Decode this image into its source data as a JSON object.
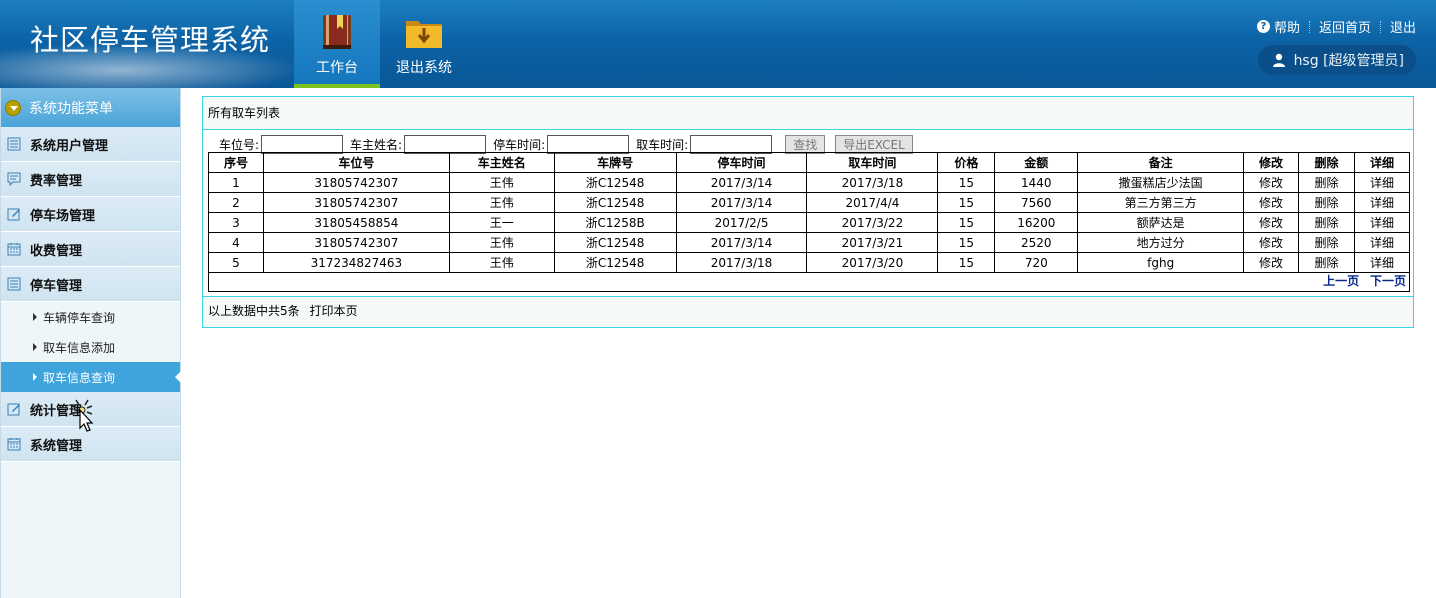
{
  "header": {
    "app_title": "社区停车管理系统",
    "nav": [
      {
        "label": "工作台",
        "icon": "book-icon",
        "active": true
      },
      {
        "label": "退出系统",
        "icon": "download-folder-icon",
        "active": false
      }
    ],
    "links": {
      "help": "帮助",
      "home": "返回首页",
      "logout": "退出"
    },
    "user": "hsg [超级管理员]"
  },
  "sidebar": {
    "header": "系统功能菜单",
    "items": [
      {
        "label": "系统用户管理",
        "icon": "list-icon"
      },
      {
        "label": "费率管理",
        "icon": "comment-icon"
      },
      {
        "label": "停车场管理",
        "icon": "edit-icon"
      },
      {
        "label": "收费管理",
        "icon": "calendar-icon"
      },
      {
        "label": "停车管理",
        "icon": "list-icon"
      }
    ],
    "subitems": [
      {
        "label": "车辆停车查询",
        "active": false
      },
      {
        "label": "取车信息添加",
        "active": false
      },
      {
        "label": "取车信息查询",
        "active": true
      }
    ],
    "items_after": [
      {
        "label": "统计管理",
        "icon": "edit-icon"
      },
      {
        "label": "系统管理",
        "icon": "calendar-icon"
      }
    ]
  },
  "main": {
    "list_title": "所有取车列表",
    "search": {
      "spot_label": "车位号:",
      "owner_label": "车主姓名:",
      "park_time_label": "停车时间:",
      "pick_time_label": "取车时间:",
      "find_button": "查找",
      "export_button": "导出EXCEL"
    },
    "table": {
      "headers": [
        "序号",
        "车位号",
        "车主姓名",
        "车牌号",
        "停车时间",
        "取车时间",
        "价格",
        "金额",
        "备注",
        "修改",
        "删除",
        "详细"
      ],
      "rows": [
        [
          "1",
          "31805742307",
          "王伟",
          "浙C12548",
          "2017/3/14",
          "2017/3/18",
          "15",
          "1440",
          "撒蛋糕店少法国",
          "修改",
          "删除",
          "详细"
        ],
        [
          "2",
          "31805742307",
          "王伟",
          "浙C12548",
          "2017/3/14",
          "2017/4/4",
          "15",
          "7560",
          "第三方第三方",
          "修改",
          "删除",
          "详细"
        ],
        [
          "3",
          "31805458854",
          "王一",
          "浙C1258B",
          "2017/2/5",
          "2017/3/22",
          "15",
          "16200",
          "额萨达是",
          "修改",
          "删除",
          "详细"
        ],
        [
          "4",
          "31805742307",
          "王伟",
          "浙C12548",
          "2017/3/14",
          "2017/3/21",
          "15",
          "2520",
          "地方过分",
          "修改",
          "删除",
          "详细"
        ],
        [
          "5",
          "317234827463",
          "王伟",
          "浙C12548",
          "2017/3/18",
          "2017/3/20",
          "15",
          "720",
          "fghg",
          "修改",
          "删除",
          "详细"
        ]
      ]
    },
    "pager": {
      "prev": "上一页",
      "next": "下一页"
    },
    "footer": {
      "summary": "以上数据中共5条",
      "print": "打印本页"
    }
  },
  "colors": {
    "header_blue": "#0c63a6",
    "accent_cyan": "#3fd3e6",
    "active_tab_bar": "#7dc21e",
    "sidebar_active": "#3fa3dc"
  }
}
